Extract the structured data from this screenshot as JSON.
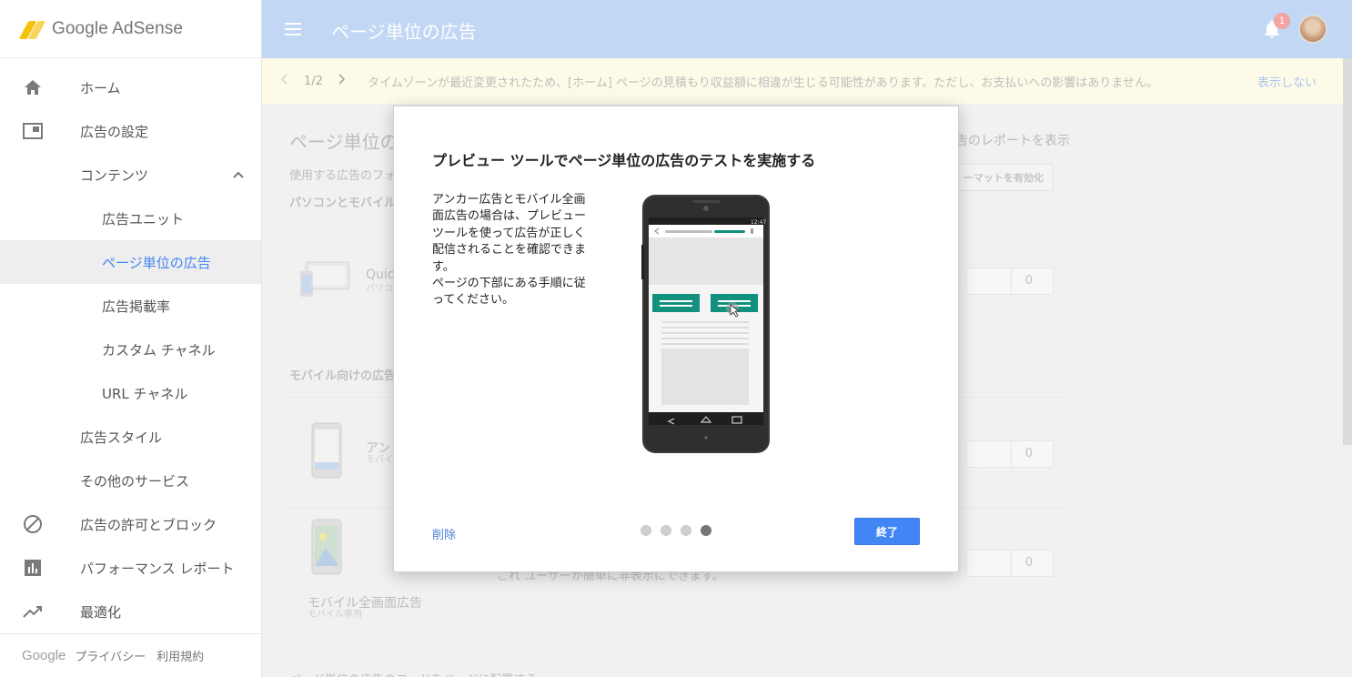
{
  "brand": {
    "name": "Google AdSense"
  },
  "sidebar": {
    "items": [
      {
        "label": "ホーム",
        "icon": "home-icon"
      },
      {
        "label": "広告の設定",
        "icon": "ad-settings-icon"
      },
      {
        "label": "コンテンツ",
        "icon": "chevron-up-icon",
        "expanded": true
      },
      {
        "label": "広告ユニット"
      },
      {
        "label": "ページ単位の広告",
        "active": true
      },
      {
        "label": "広告掲載率"
      },
      {
        "label": "カスタム チャネル"
      },
      {
        "label": "URL チャネル"
      },
      {
        "label": "広告スタイル"
      },
      {
        "label": "その他のサービス"
      },
      {
        "label": "広告の許可とブロック",
        "icon": "block-icon"
      },
      {
        "label": "パフォーマンス レポート",
        "icon": "bar-chart-icon"
      },
      {
        "label": "最適化",
        "icon": "trending-up-icon"
      }
    ],
    "footer": {
      "logo": "Google",
      "privacy": "プライバシー",
      "terms": "利用規約"
    }
  },
  "header": {
    "title": "ページ単位の広告",
    "notification_count": "1"
  },
  "banner": {
    "counter": "1/2",
    "message": "タイムゾーンが最近変更されたため、[ホーム] ページの見積もり収益額に相違が生じる可能性があります。ただし、お支払いへの影響はありません。",
    "dismiss": "表示しない"
  },
  "background": {
    "title": "ページ単位の広",
    "report_link": "告のレポートを表示",
    "subtitle": "使用する広告のフォ",
    "enable_button": "ーマットを有効化",
    "section1": "パソコンとモバイル",
    "quick_label": "Quick",
    "quick_sub": "パソコン",
    "section2": "モバイル向けの広告",
    "anchor_label": "アン",
    "anchor_sub": "モバイ",
    "interstitial_label": "モバイル全画面広告",
    "interstitial_sub": "モバイル専用",
    "interstitial_desc": "これ ユーザーが簡単に非表示にできます。",
    "bottom_section": "ページ単位の広告のコードをページに配置する",
    "counts": [
      "0",
      "0",
      "0"
    ]
  },
  "dialog": {
    "title": "プレビュー ツールでページ単位の広告のテストを実施する",
    "body": [
      "アンカー広告とモバイル全画面広告の場合は、プレビュー ツールを使って広告が正しく配信されることを確認できます。",
      "ページの下部にある手順に従ってください。"
    ],
    "delete_label": "削除",
    "finish_label": "終了",
    "steps_total": 4,
    "step_current": 4,
    "phone_time": "12:47"
  },
  "colors": {
    "header_bg": "#c1d7f3",
    "accent_blue": "#4285f4",
    "phone_teal": "#12917f",
    "banner_bg": "#fdfbe8"
  }
}
